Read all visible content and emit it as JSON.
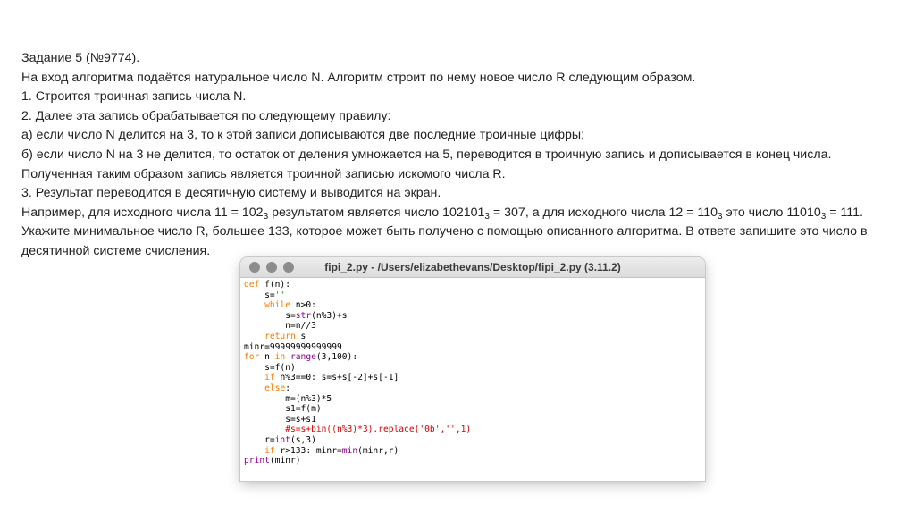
{
  "task": {
    "title": "Задание 5 (№9774).",
    "intro": "На вход алгоритма подаётся натуральное число N. Алгоритм строит по нему новое число R следующим образом.",
    "step1": "1. Строится троичная запись числа N.",
    "step2": "2. Далее эта запись обрабатывается по следующему правилу:",
    "rule_a": "а) если число N делится на 3, то к этой записи дописываются две последние троичные цифры;",
    "rule_b": "б) если число N на 3 не делится, то остаток от деления умножается на 5, переводится в троичную запись и дописывается в конец числа.",
    "result_note": "Полученная таким образом запись является троичной записью искомого числа R.",
    "step3": "3. Результат переводится в десятичную систему и выводится на экран.",
    "example": {
      "p1": "Например, для исходного числа 11 = 102",
      "s1": "3",
      "p2": " результатом является число 102101",
      "s2": "3",
      "p3": " = 307, а для исходного числа 12 = 110",
      "s3": "3",
      "p4": " это число 11010",
      "s4": "3",
      "p5": " = 111."
    },
    "question": "Укажите минимальное число R, большее 133, которое может быть получено с помощью описанного алгоритма. В ответе запишите это число в десятичной системе счисления."
  },
  "window": {
    "title": "fipi_2.py - /Users/elizabethevans/Desktop/fipi_2.py (3.11.2)",
    "buttons": [
      "close",
      "minimize",
      "zoom"
    ],
    "code_colors": {
      "keyword": "#ff7700",
      "builtin": "#900090",
      "string": "#00aa00",
      "comment": "#dd0000"
    }
  },
  "code": {
    "l01": [
      "def",
      " f(n):"
    ],
    "l02": [
      "    s=",
      "''"
    ],
    "l03": [
      "    ",
      "while",
      " n>0:"
    ],
    "l04": [
      "        s=",
      "str",
      "(n%3)+s"
    ],
    "l05": [
      "        n=n//3"
    ],
    "l06": [
      "    ",
      "return",
      " s"
    ],
    "l07": [
      "minr=99999999999999"
    ],
    "l08": [
      "for",
      " n ",
      "in",
      " ",
      "range",
      "(3,100):"
    ],
    "l09": [
      "    s=f(n)"
    ],
    "l10": [
      "    ",
      "if",
      " n%3==0: s=s+s[-2]+s[-1]"
    ],
    "l11": [
      "    ",
      "else",
      ":"
    ],
    "l12": [
      "        m=(n%3)*5"
    ],
    "l13": [
      "        s1=f(m)"
    ],
    "l14": [
      "        s=s+s1"
    ],
    "l15": [
      "        #s=s+bin((n%3)*3).replace('0b','',1)"
    ],
    "l16": [
      "    r=",
      "int",
      "(s,3)"
    ],
    "l17": [
      "    ",
      "if",
      " r>133: minr=",
      "min",
      "(minr,r)"
    ],
    "l18": [
      "print",
      "(minr)"
    ]
  }
}
